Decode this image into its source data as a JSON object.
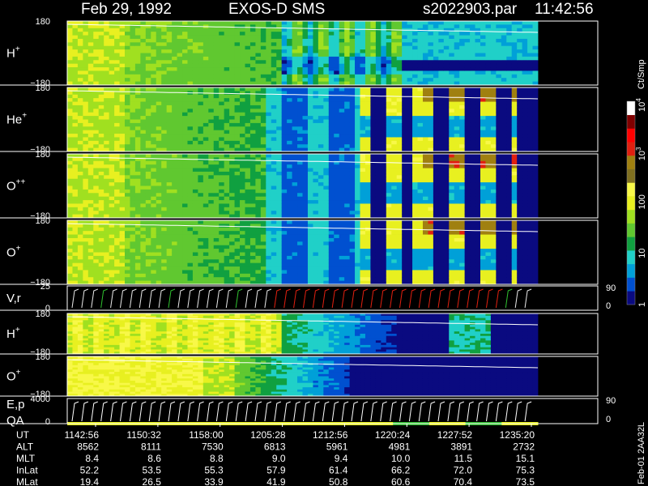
{
  "header": {
    "date": "Feb 29, 1992",
    "instrument": "EXOS-D SMS",
    "file": "s2022903.par",
    "time": "11:42:56"
  },
  "side_label": "Feb-01 2AA32L",
  "colorbar": {
    "unit_label": "Ct/Smp",
    "scale": "log",
    "range": [
      1,
      10000
    ],
    "ticks": [
      {
        "label": "1",
        "value": 1
      },
      {
        "label": "10",
        "value": 10
      },
      {
        "label": "100",
        "value": 100
      },
      {
        "label": "10",
        "sup": "3",
        "value": 1000
      },
      {
        "label": "10",
        "sup": "4",
        "value": 10000
      }
    ],
    "colors": [
      "#0a0a80",
      "#0050d0",
      "#00a0d8",
      "#20d0c8",
      "#10a040",
      "#60c830",
      "#a0e020",
      "#e8f020",
      "#f8f848",
      "#807020",
      "#a08010",
      "#e02010",
      "#ff0000",
      "#800000",
      "#ffffff"
    ]
  },
  "ephemeris": {
    "rows": [
      {
        "label": "UT",
        "values": [
          "1142:56",
          "1150:32",
          "1158:00",
          "1205:28",
          "1212:56",
          "1220:24",
          "1227:52",
          "1235:20"
        ]
      },
      {
        "label": "ALT",
        "values": [
          "8562",
          "8111",
          "7530",
          "6813",
          "5961",
          "4981",
          "3891",
          "2732"
        ]
      },
      {
        "label": "MLT",
        "values": [
          "8.4",
          "8.6",
          "8.8",
          "9.0",
          "9.4",
          "10.0",
          "11.5",
          "15.1"
        ]
      },
      {
        "label": "InLat",
        "values": [
          "52.2",
          "53.5",
          "55.3",
          "57.9",
          "61.4",
          "66.2",
          "72.0",
          "75.3"
        ]
      },
      {
        "label": "MLat",
        "values": [
          "19.4",
          "26.5",
          "33.9",
          "41.9",
          "50.8",
          "60.6",
          "70.4",
          "73.5"
        ]
      }
    ]
  },
  "chart_data": {
    "type": "heatmap",
    "x": {
      "ticks": [
        "1142:56",
        "1150:32",
        "1158:00",
        "1205:28",
        "1212:56",
        "1220:24",
        "1227:52",
        "1235:20"
      ]
    },
    "panels": [
      {
        "id": "h1",
        "species": "H",
        "charge": "+",
        "type": "heatmap",
        "ytop": "180",
        "ybot": "−180",
        "ylim": [
          -180,
          180
        ],
        "profile": "h1"
      },
      {
        "id": "he1",
        "species": "He",
        "charge": "+",
        "type": "heatmap",
        "ytop": "180",
        "ybot": "−180",
        "ylim": [
          -180,
          180
        ],
        "profile": "he1"
      },
      {
        "id": "o2",
        "species": "O",
        "charge": "++",
        "type": "heatmap",
        "ytop": "180",
        "ybot": "−180",
        "ylim": [
          -180,
          180
        ],
        "profile": "o2"
      },
      {
        "id": "o1",
        "species": "O",
        "charge": "+",
        "type": "heatmap",
        "ytop": "180",
        "ybot": "−180",
        "ylim": [
          -180,
          180
        ],
        "profile": "o1"
      },
      {
        "id": "vr",
        "species": "V,r",
        "charge": "",
        "type": "vector",
        "ytop": "25",
        "ybot": "0",
        "ylim": [
          0,
          25
        ],
        "rtop": "90",
        "rbot": "0"
      },
      {
        "id": "h2",
        "species": "H",
        "charge": "+",
        "type": "heatmap",
        "ytop": "180",
        "ybot": "−180",
        "ylim": [
          -180,
          180
        ],
        "profile": "h2"
      },
      {
        "id": "o3",
        "species": "O",
        "charge": "+",
        "type": "heatmap",
        "ytop": "180",
        "ybot": "−180",
        "ylim": [
          -180,
          180
        ],
        "profile": "o3"
      },
      {
        "id": "ep",
        "species": "E,p",
        "charge": "",
        "species2": "QA",
        "type": "vector",
        "ytop": "4000",
        "ybot": "0",
        "ylim": [
          0,
          4000
        ],
        "rtop": "90",
        "rbot": "0"
      }
    ]
  }
}
